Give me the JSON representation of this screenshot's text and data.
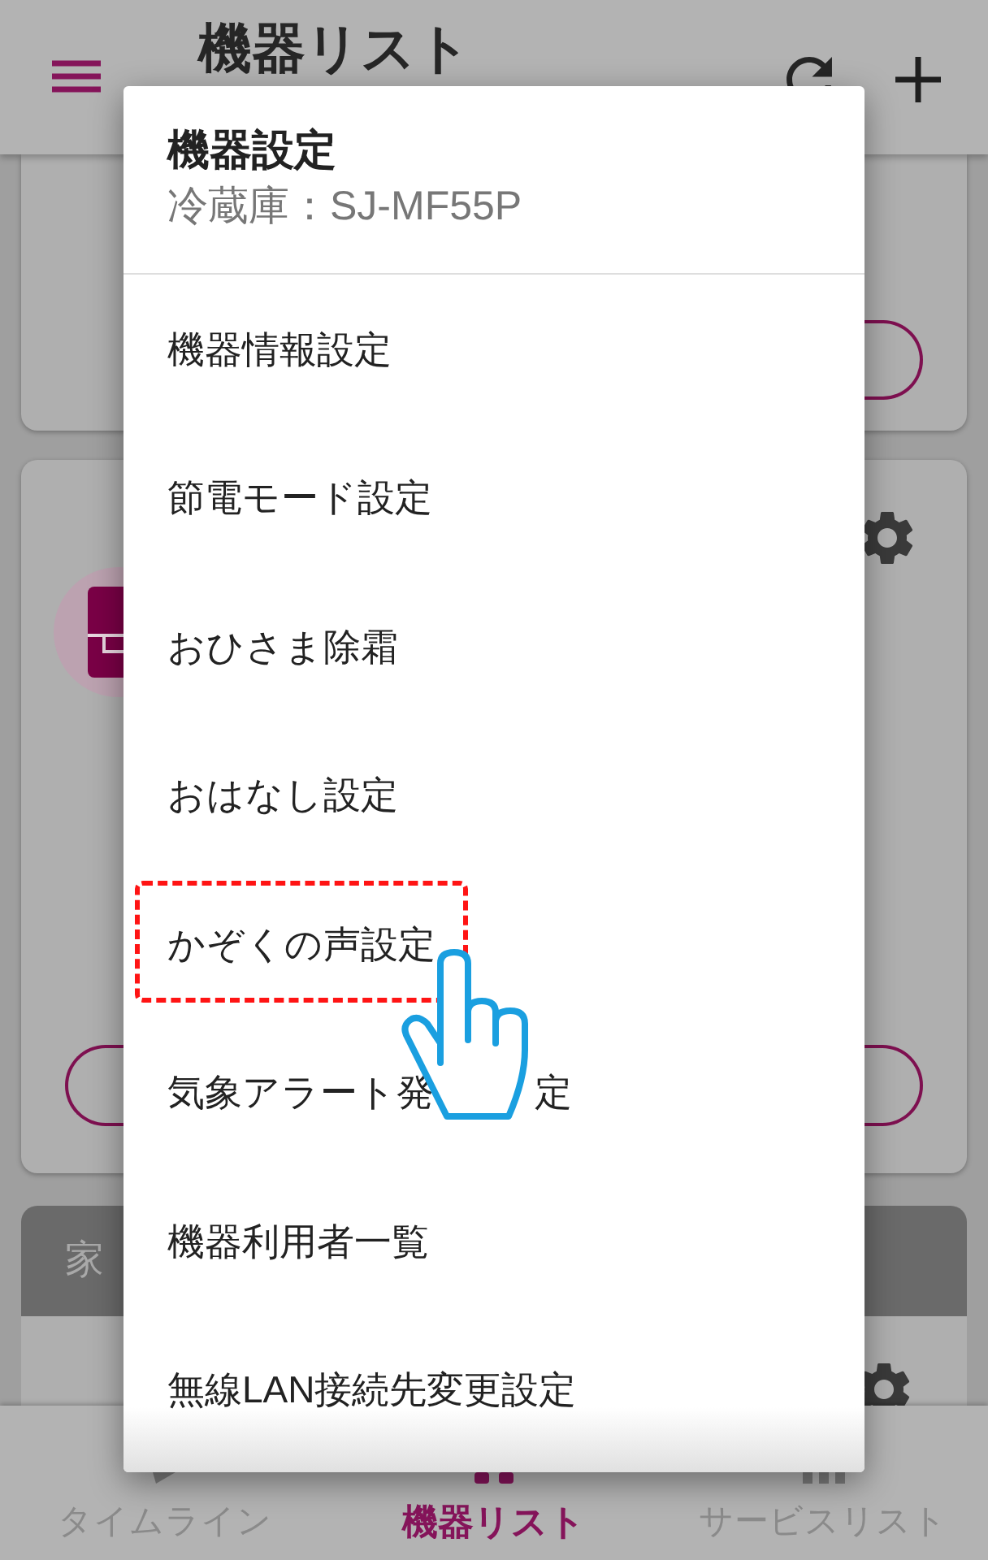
{
  "header": {
    "title": "機器リスト"
  },
  "section_header": {
    "title": "家"
  },
  "tab_bar": {
    "tabs": [
      {
        "label": "タイムライン",
        "selected": false
      },
      {
        "label": "機器リスト",
        "selected": true
      },
      {
        "label": "サービスリスト",
        "selected": false
      }
    ]
  },
  "dialog": {
    "title": "機器設定",
    "subtitle": "冷蔵庫：SJ-MF55P",
    "items": [
      {
        "label": "機器情報設定",
        "highlighted": false
      },
      {
        "label": "節電モード設定",
        "highlighted": false
      },
      {
        "label": "おひさま除霜",
        "highlighted": false
      },
      {
        "label": "おはなし設定",
        "highlighted": false
      },
      {
        "label": "かぞくの声設定",
        "highlighted": true
      },
      {
        "label": "気象アラート発",
        "label_tail": "定",
        "highlighted": false
      },
      {
        "label": "機器利用者一覧",
        "highlighted": false
      },
      {
        "label": "無線LAN接続先変更設定",
        "highlighted": false
      }
    ]
  }
}
